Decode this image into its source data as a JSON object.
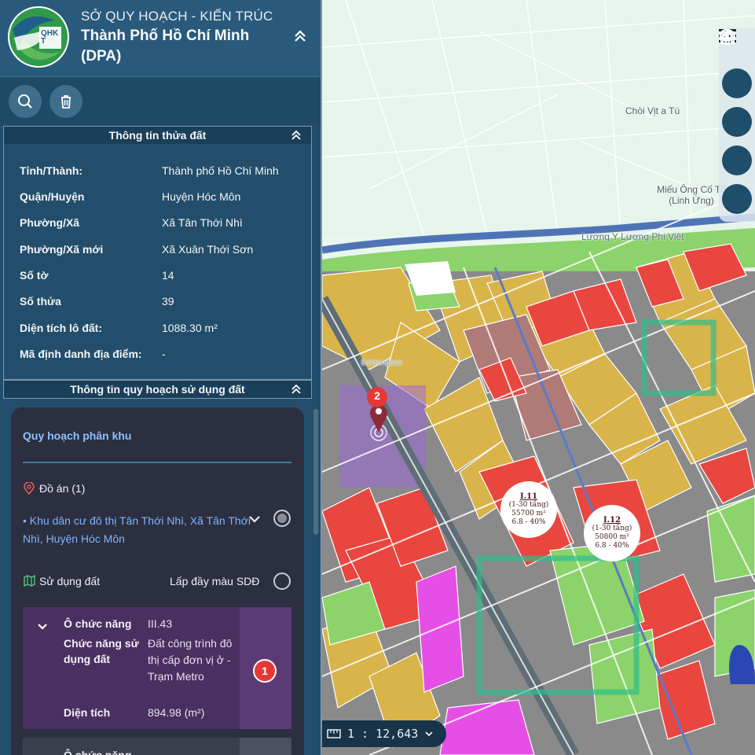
{
  "header": {
    "org_name": "SỞ QUY HOẠCH - KIẾN TRÚC",
    "city_name": "Thành Phố Hồ Chí Minh (DPA)",
    "logo_text": "QHKT"
  },
  "land_info": {
    "title": "Thông tin thửa đất",
    "rows": [
      {
        "key": "Tỉnh/Thành:",
        "value": "Thành phố Hồ Chí Minh"
      },
      {
        "key": "Quận/Huyện",
        "value": "Huyện Hóc Môn"
      },
      {
        "key": "Phường/Xã",
        "value": "Xã Tân Thới Nhì"
      },
      {
        "key": "Phường/Xã mới",
        "value": "Xã Xuân Thới Sơn"
      },
      {
        "key": "Số tờ",
        "value": "14"
      },
      {
        "key": "Số thửa",
        "value": "39"
      },
      {
        "key": "Diện tích lô đất:",
        "value": "1088.30 m²"
      },
      {
        "key": "Mã định danh địa điểm:",
        "value": "-"
      }
    ]
  },
  "planning_info": {
    "title": "Thông tin quy hoạch sử dụng đất",
    "card_title": "Quy hoạch phân khu",
    "project_label": "Đồ án (1)",
    "project_name": "• Khu dân cư đô thị Tân Thới Nhì, Xã Tân Thới Nhì, Huyện Hóc Môn",
    "land_use_label": "Sử dụng đất",
    "fill_color_label": "Lấp đầy màu SDĐ",
    "function_block": {
      "k1": "Ô chức năng",
      "v1": "III.43",
      "k2": "Chức năng sử dụng đất",
      "v2": "Đất công trình đô thị cấp đơn vị ở - Trạm Metro",
      "k3": "Diện tích",
      "v3": "894.98 (m²)",
      "badge": "1"
    },
    "next_block_label": "Ô chức năng"
  },
  "map": {
    "marker_count": "2",
    "labels": {
      "poi_1": "Chòi Vịt a Tú",
      "poi_2": "Miếu Ông Cố Tổ (Linh Ứng)",
      "street": "Lương Y Lương Phi Việt",
      "watermark": "batdongsan"
    },
    "parcels": [
      {
        "code": "I.11",
        "floors": "(1-30 tầng)",
        "area": "55700 m²",
        "ratio": "6.8 - 40%"
      },
      {
        "code": "I.12",
        "floors": "(1-30 tầng)",
        "area": "50800 m²",
        "ratio": "6.8 - 40%"
      }
    ],
    "scale": "1 : 12,643",
    "colors": {
      "residential": "#d9b44a",
      "commercial": "#e8463f",
      "green": "#8bd36a",
      "public": "#e64fe6",
      "river": "#4f74b6",
      "road": "#9a9a9a",
      "mixed": "#b07a77"
    }
  },
  "controls": [
    "menu-icon",
    "zoom-in-icon",
    "zoom-out-icon",
    "locate-icon",
    "home-icon"
  ]
}
